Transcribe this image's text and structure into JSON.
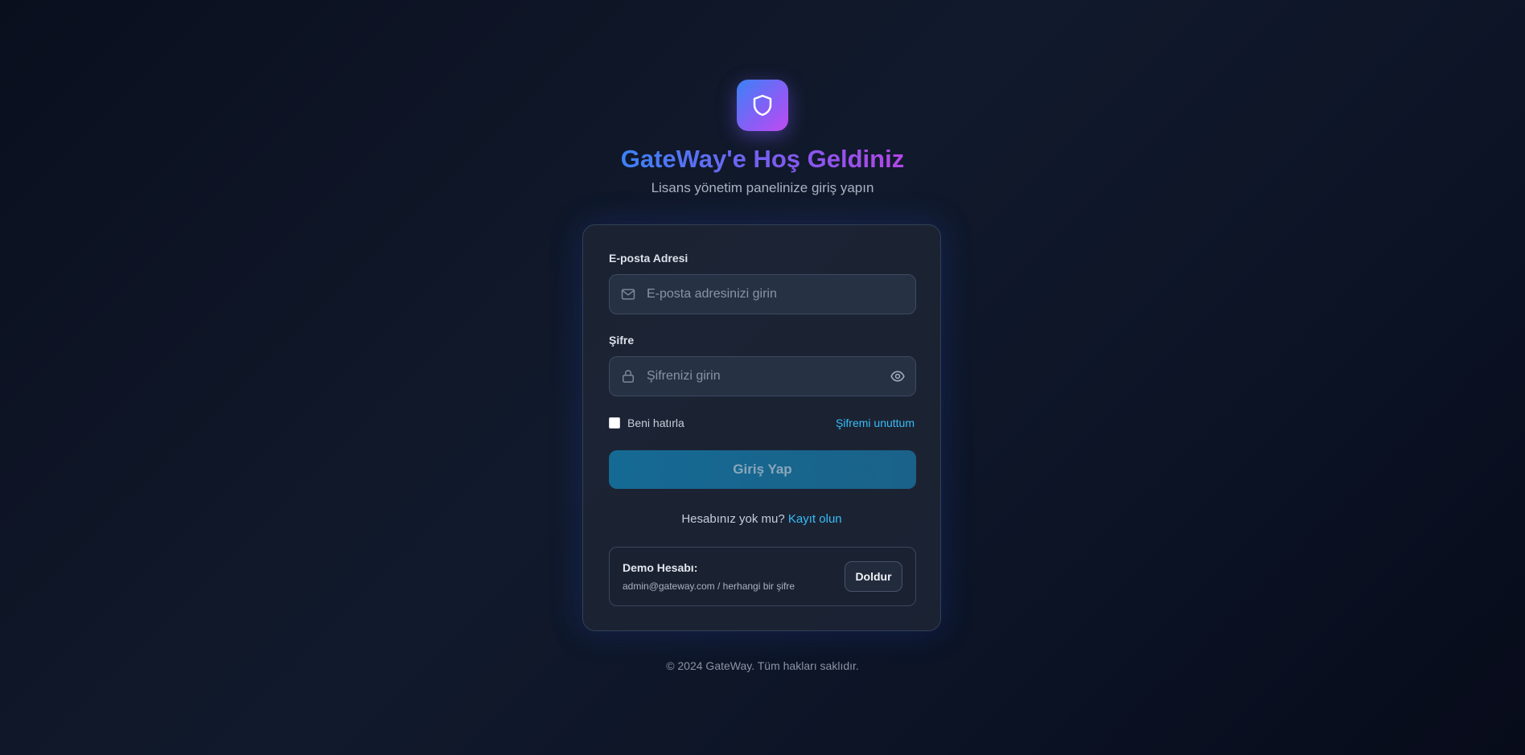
{
  "brand": {
    "logo_icon": "shield-icon",
    "title": "GateWay'e Hoş Geldiniz",
    "subtitle": "Lisans yönetim panelinize giriş yapın"
  },
  "form": {
    "email": {
      "label": "E-posta Adresi",
      "placeholder": "E-posta adresinizi girin",
      "value": "",
      "icon": "mail-icon"
    },
    "password": {
      "label": "Şifre",
      "placeholder": "Şifrenizi girin",
      "value": "",
      "icon": "lock-icon",
      "toggle_icon": "eye-icon"
    },
    "remember_label": "Beni hatırla",
    "remember_checked": false,
    "forgot_label": "Şifremi unuttum",
    "submit_label": "Giriş Yap",
    "signup_prompt": "Hesabınız yok mu?",
    "signup_link": "Kayıt olun"
  },
  "demo": {
    "title": "Demo Hesabı:",
    "credentials": "admin@gateway.com / herhangi bir şifre",
    "fill_label": "Doldur"
  },
  "footer": {
    "text": "© 2024 GateWay. Tüm hakları saklıdır."
  },
  "colors": {
    "accent": "#38bdf8",
    "button": "#156a94",
    "gradient_start": "#3b82f6",
    "gradient_end": "#b347e8"
  }
}
